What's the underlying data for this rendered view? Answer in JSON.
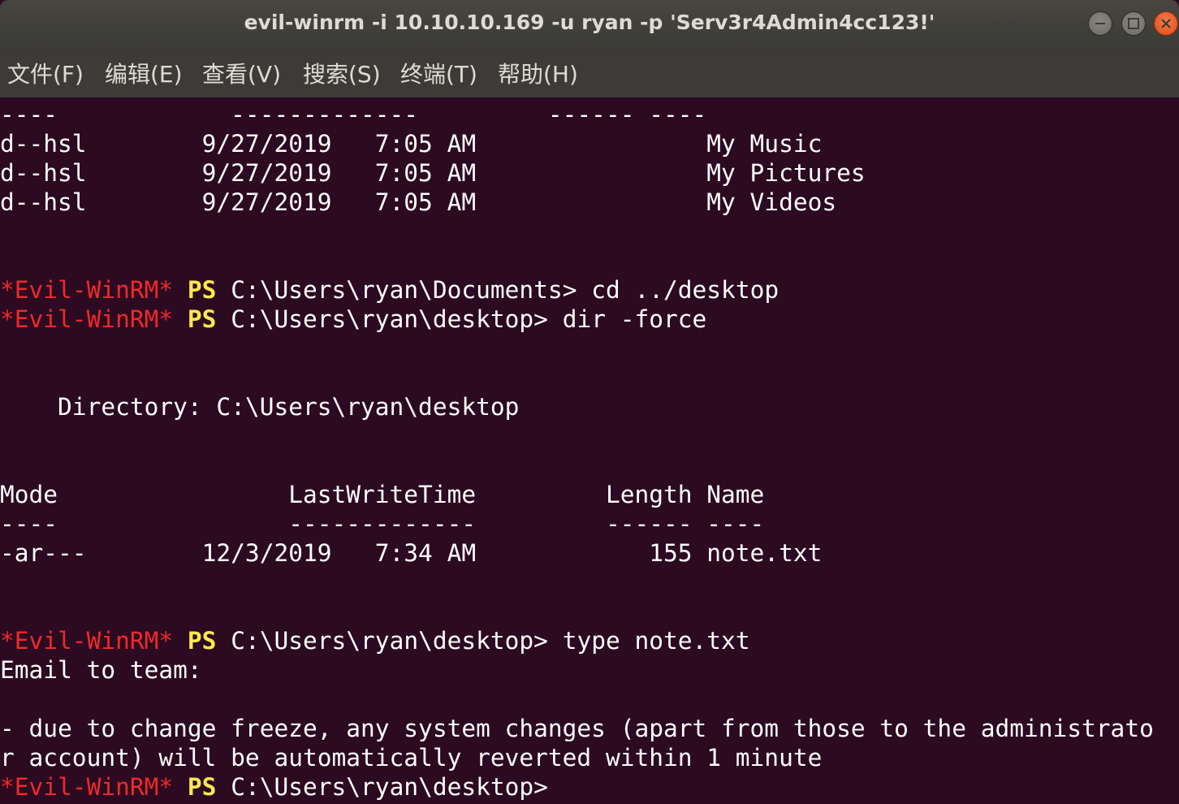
{
  "window": {
    "title": "evil-winrm -i 10.10.10.169 -u ryan -p 'Serv3r4Admin4cc123!'",
    "controls": [
      "minimize",
      "maximize",
      "close"
    ]
  },
  "menubar": {
    "items": [
      {
        "label": "文件(F)"
      },
      {
        "label": "编辑(E)"
      },
      {
        "label": "查看(V)"
      },
      {
        "label": "搜索(S)"
      },
      {
        "label": "终端(T)"
      },
      {
        "label": "帮助(H)"
      }
    ]
  },
  "colors": {
    "terminal_bg": "#2c0a22",
    "prompt_tag": "#ef2929",
    "prompt_ps": "#fce94f",
    "text": "#ffffff"
  },
  "terminal": {
    "lines": [
      {
        "text": "----            -------------         ------ ----"
      },
      {
        "text": "d--hsl        9/27/2019   7:05 AM                My Music"
      },
      {
        "text": "d--hsl        9/27/2019   7:05 AM                My Pictures"
      },
      {
        "text": "d--hsl        9/27/2019   7:05 AM                My Videos"
      },
      {
        "text": ""
      },
      {
        "text": ""
      },
      {
        "prompt_tag": "*Evil-WinRM*",
        "ps": "PS",
        "rest": " C:\\Users\\ryan\\Documents> cd ../desktop"
      },
      {
        "prompt_tag": "*Evil-WinRM*",
        "ps": "PS",
        "rest": " C:\\Users\\ryan\\desktop> dir -force"
      },
      {
        "text": ""
      },
      {
        "text": ""
      },
      {
        "text": "    Directory: C:\\Users\\ryan\\desktop"
      },
      {
        "text": ""
      },
      {
        "text": ""
      },
      {
        "text": "Mode                LastWriteTime         Length Name"
      },
      {
        "text": "----                -------------         ------ ----"
      },
      {
        "text": "-ar---        12/3/2019   7:34 AM            155 note.txt"
      },
      {
        "text": ""
      },
      {
        "text": ""
      },
      {
        "prompt_tag": "*Evil-WinRM*",
        "ps": "PS",
        "rest": " C:\\Users\\ryan\\desktop> type note.txt"
      },
      {
        "text": "Email to team:"
      },
      {
        "text": ""
      },
      {
        "text": "- due to change freeze, any system changes (apart from those to the administrato"
      },
      {
        "text": "r account) will be automatically reverted within 1 minute"
      },
      {
        "prompt_tag": "*Evil-WinRM*",
        "ps": "PS",
        "rest": " C:\\Users\\ryan\\desktop>"
      }
    ]
  }
}
